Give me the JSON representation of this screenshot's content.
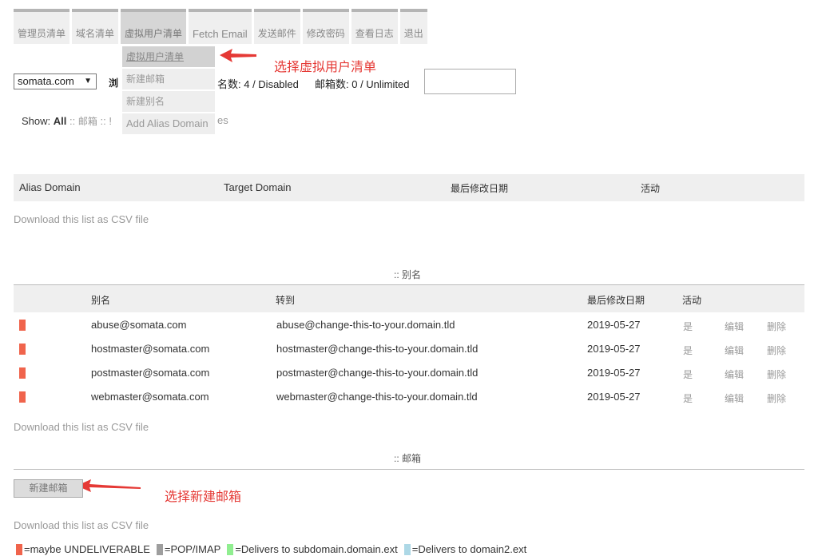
{
  "nav": {
    "items": [
      {
        "label": "管理员清单"
      },
      {
        "label": "域名清单"
      },
      {
        "label": "虚拟用户清单"
      },
      {
        "label": "Fetch Email"
      },
      {
        "label": "发送邮件"
      },
      {
        "label": "修改密码"
      },
      {
        "label": "查看日志"
      },
      {
        "label": "退出"
      }
    ]
  },
  "dropdown": {
    "items": [
      {
        "label": "虚拟用户清单"
      },
      {
        "label": "新建邮箱"
      },
      {
        "label": "新建别名"
      },
      {
        "label": "Add Alias Domain"
      }
    ]
  },
  "annotations": {
    "select_vusers": "选择虚拟用户清单",
    "select_new_mailbox": "选择新建邮箱"
  },
  "toolbar": {
    "domain_selected": "somata.com",
    "browse_label": "浏",
    "alias_count": "名数: 4 / Disabled",
    "mailbox_count": "邮箱数: 0 / Unlimited"
  },
  "show": {
    "prefix": "Show:",
    "all": "All",
    "sep1": "::",
    "mailbox": "邮箱",
    "sep2": "::",
    "partial": "!",
    "tail": "es"
  },
  "alias_domains": {
    "headers": {
      "alias_domain": "Alias Domain",
      "target_domain": "Target Domain",
      "modified": "最后修改日期",
      "active": "活动"
    },
    "csv": "Download this list as CSV file"
  },
  "aliases": {
    "title": ":: 别名",
    "headers": {
      "alias": "别名",
      "goto": "转到",
      "modified": "最后修改日期",
      "active": "活动"
    },
    "rows": [
      {
        "alias": "abuse@somata.com",
        "goto": "abuse@change-this-to-your.domain.tld",
        "modified": "2019-05-27",
        "active": "是",
        "edit": "编辑",
        "delete": "删除"
      },
      {
        "alias": "hostmaster@somata.com",
        "goto": "hostmaster@change-this-to-your.domain.tld",
        "modified": "2019-05-27",
        "active": "是",
        "edit": "编辑",
        "delete": "删除"
      },
      {
        "alias": "postmaster@somata.com",
        "goto": "postmaster@change-this-to-your.domain.tld",
        "modified": "2019-05-27",
        "active": "是",
        "edit": "编辑",
        "delete": "删除"
      },
      {
        "alias": "webmaster@somata.com",
        "goto": "webmaster@change-this-to-your.domain.tld",
        "modified": "2019-05-27",
        "active": "是",
        "edit": "编辑",
        "delete": "删除"
      }
    ],
    "csv": "Download this list as CSV file"
  },
  "mailboxes": {
    "title": ":: 邮箱",
    "new_button": "新建邮箱",
    "csv": "Download this list as CSV file"
  },
  "legend": [
    {
      "color": "#f0644c",
      "label": "=maybe UNDELIVERABLE"
    },
    {
      "color": "#9e9e9e",
      "label": "=POP/IMAP"
    },
    {
      "color": "#90ee90",
      "label": "=Delivers to subdomain.domain.ext"
    },
    {
      "color": "#add8e6",
      "label": "=Delivers to domain2.ext"
    }
  ],
  "colors": {
    "marker": "#f0644c",
    "annotation": "#e53935"
  }
}
